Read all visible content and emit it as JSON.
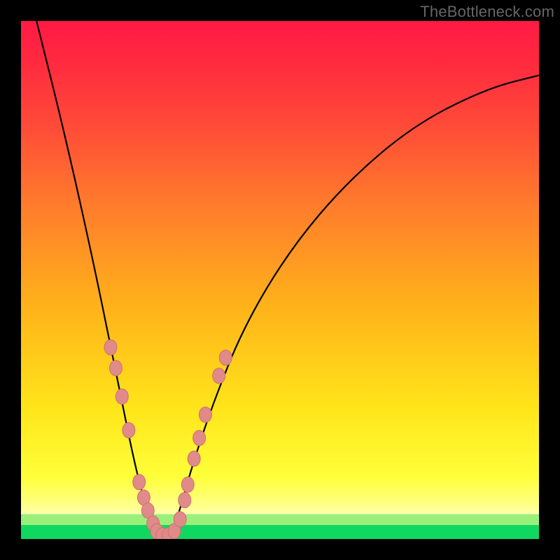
{
  "watermark": "TheBottleneck.com",
  "colors": {
    "background_frame": "#000000",
    "gradient_stops": [
      {
        "pos": 0,
        "color": "#ff1a44"
      },
      {
        "pos": 0.35,
        "color": "#ff7a2c"
      },
      {
        "pos": 0.75,
        "color": "#ffe61a"
      },
      {
        "pos": 0.952,
        "color": "#ffffb0"
      },
      {
        "pos": 0.952,
        "color": "#9af07a"
      },
      {
        "pos": 0.973,
        "color": "#9af07a"
      },
      {
        "pos": 0.973,
        "color": "#0fd860"
      },
      {
        "pos": 1.0,
        "color": "#0fd860"
      }
    ],
    "curve": "#000000",
    "bead_fill": "#e08a8a",
    "bead_stroke": "#d16f6f"
  },
  "chart_data": {
    "type": "line",
    "title": "",
    "xlabel": "",
    "ylabel": "",
    "x_range": [
      0,
      1
    ],
    "y_range": [
      0,
      1
    ],
    "notes": "Single V-shaped bottleneck curve on a heat-map gradient; minimum near x≈0.275 touching the green band (y≈0). Left branch rises steeply to top-left; right branch rises with decreasing slope toward top-right. No axes, ticks, or labels shown.",
    "series": [
      {
        "name": "bottleneck-curve",
        "x": [
          0.03,
          0.08,
          0.13,
          0.18,
          0.22,
          0.245,
          0.26,
          0.275,
          0.29,
          0.305,
          0.33,
          0.37,
          0.43,
          0.52,
          0.63,
          0.76,
          0.9,
          1.0
        ],
        "y": [
          1.0,
          0.8,
          0.58,
          0.34,
          0.14,
          0.05,
          0.01,
          0.0,
          0.01,
          0.05,
          0.14,
          0.26,
          0.41,
          0.56,
          0.69,
          0.8,
          0.87,
          0.895
        ]
      }
    ],
    "markers": {
      "name": "beads-on-curve",
      "description": "Pink elliptical beads clustered densely near the curve minimum on both branches, sparser farther up.",
      "points": [
        {
          "x": 0.173,
          "y": 0.37
        },
        {
          "x": 0.183,
          "y": 0.33
        },
        {
          "x": 0.195,
          "y": 0.275
        },
        {
          "x": 0.208,
          "y": 0.21
        },
        {
          "x": 0.228,
          "y": 0.11
        },
        {
          "x": 0.237,
          "y": 0.08
        },
        {
          "x": 0.245,
          "y": 0.055
        },
        {
          "x": 0.255,
          "y": 0.03
        },
        {
          "x": 0.262,
          "y": 0.015
        },
        {
          "x": 0.273,
          "y": 0.007
        },
        {
          "x": 0.285,
          "y": 0.007
        },
        {
          "x": 0.296,
          "y": 0.015
        },
        {
          "x": 0.307,
          "y": 0.038
        },
        {
          "x": 0.316,
          "y": 0.075
        },
        {
          "x": 0.322,
          "y": 0.105
        },
        {
          "x": 0.334,
          "y": 0.155
        },
        {
          "x": 0.344,
          "y": 0.195
        },
        {
          "x": 0.356,
          "y": 0.24
        },
        {
          "x": 0.382,
          "y": 0.315
        },
        {
          "x": 0.395,
          "y": 0.35
        }
      ]
    }
  }
}
